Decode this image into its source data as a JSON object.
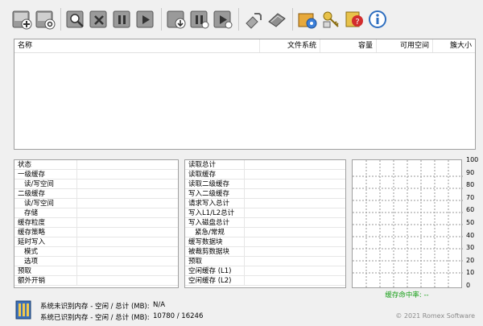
{
  "toolbar": {
    "buttons": [
      {
        "name": "add-cache-task",
        "icon": "disk-plus-icon"
      },
      {
        "name": "cache-settings",
        "icon": "disk-gear-icon"
      },
      {
        "name": "view-task",
        "icon": "magnifier-icon"
      },
      {
        "name": "remove-task",
        "icon": "x-icon"
      },
      {
        "name": "pause-task",
        "icon": "pause-icon"
      },
      {
        "name": "start-task",
        "icon": "play-icon"
      },
      {
        "name": "flush-cache",
        "icon": "arrow-down-icon"
      },
      {
        "name": "pause-all",
        "icon": "pause-all-icon"
      },
      {
        "name": "resume-all",
        "icon": "resume-all-icon"
      },
      {
        "name": "tools",
        "icon": "wrench-icon"
      },
      {
        "name": "book",
        "icon": "book-icon"
      },
      {
        "name": "settings",
        "icon": "settings-box-icon"
      },
      {
        "name": "license",
        "icon": "keys-icon"
      },
      {
        "name": "help",
        "icon": "help-icon"
      },
      {
        "name": "about",
        "icon": "info-icon"
      }
    ]
  },
  "volumes": {
    "columns": {
      "name": "名称",
      "filesystem": "文件系统",
      "capacity": "容量",
      "free": "可用空间",
      "block": "簇大小"
    }
  },
  "left_stats": [
    {
      "label": "状态",
      "indent": false
    },
    {
      "label": "一级缓存",
      "indent": false
    },
    {
      "label": "读/写空间",
      "indent": true
    },
    {
      "label": "二级缓存",
      "indent": false
    },
    {
      "label": "读/写空间",
      "indent": true
    },
    {
      "label": "存储",
      "indent": true
    },
    {
      "label": "缓存粒度",
      "indent": false
    },
    {
      "label": "缓存策略",
      "indent": false
    },
    {
      "label": "延时写入",
      "indent": false
    },
    {
      "label": "模式",
      "indent": true
    },
    {
      "label": "选项",
      "indent": true
    },
    {
      "label": "预取",
      "indent": false
    },
    {
      "label": "额外开销",
      "indent": false
    }
  ],
  "mid_stats": [
    {
      "label": "读取总计",
      "indent": false
    },
    {
      "label": "读取缓存",
      "indent": false
    },
    {
      "label": "读取二级缓存",
      "indent": false
    },
    {
      "label": "写入二级缓存",
      "indent": false
    },
    {
      "label": "请求写入总计",
      "indent": false
    },
    {
      "label": "写入L1/L2总计",
      "indent": false
    },
    {
      "label": "写入磁盘总计",
      "indent": false
    },
    {
      "label": "紧急/常规",
      "indent": true
    },
    {
      "label": "缓写数据块",
      "indent": false
    },
    {
      "label": "被裁剪数据块",
      "indent": false
    },
    {
      "label": "预取",
      "indent": false
    },
    {
      "label": "空闲缓存 (L1)",
      "indent": false
    },
    {
      "label": "空闲缓存 (L2)",
      "indent": false
    }
  ],
  "graph": {
    "ticks": [
      "100",
      "90",
      "80",
      "70",
      "60",
      "50",
      "40",
      "30",
      "20",
      "10",
      "0"
    ],
    "hit_rate_label": "缓存命中率: --"
  },
  "memory": {
    "unrecognized_label": "系统未识别内存 - 空闲 / 总计 (MB):",
    "unrecognized_value": "N/A",
    "recognized_label": "系统已识别内存 - 空闲 / 总计 (MB):",
    "recognized_value": "10780 / 16246"
  },
  "copyright": "© 2021 Romex Software"
}
